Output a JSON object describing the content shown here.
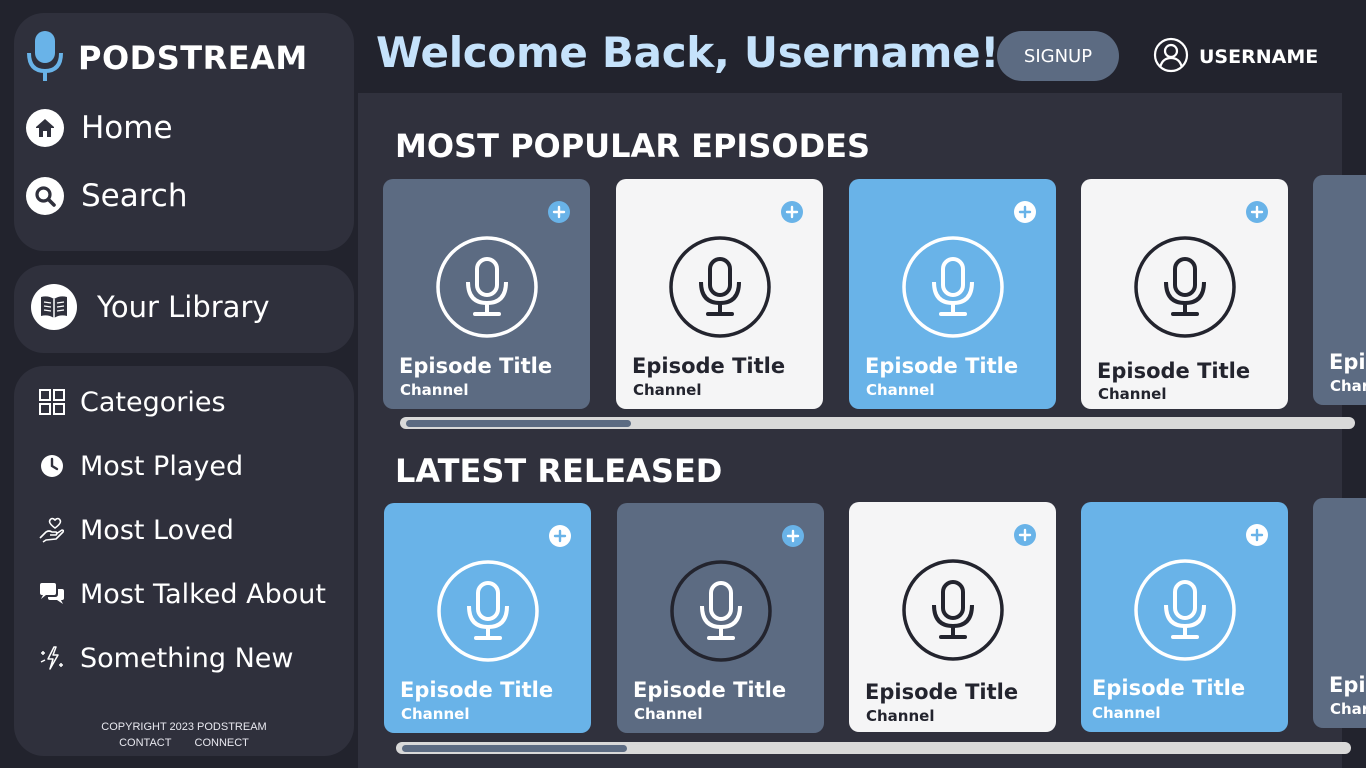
{
  "app": {
    "name": "PODSTREAM",
    "accent_color": "#69b3e8",
    "slate_color": "#5c6b82",
    "welcome_color": "#c5e2fb"
  },
  "sidebar": {
    "nav": [
      {
        "label": "Home",
        "icon": "home-icon"
      },
      {
        "label": "Search",
        "icon": "search-icon"
      }
    ],
    "library": {
      "label": "Your Library",
      "icon": "book-icon"
    },
    "categories": [
      {
        "label": "Categories",
        "icon": "grid-icon"
      },
      {
        "label": "Most Played",
        "icon": "clock-icon"
      },
      {
        "label": "Most Loved",
        "icon": "heart-hand-icon"
      },
      {
        "label": "Most Talked About",
        "icon": "chat-bubbles-icon"
      },
      {
        "label": "Something New",
        "icon": "sparkle-icon"
      }
    ],
    "footer": {
      "copyright": "COPYRIGHT 2023 PODSTREAM",
      "contact": "CONTACT",
      "connect": "CONNECT"
    }
  },
  "header": {
    "welcome": "Welcome Back, Username!",
    "signup_label": "SIGNUP",
    "username": "USERNAME"
  },
  "sections": [
    {
      "title": "MOST POPULAR EPISODES",
      "cards": [
        {
          "title": "Episode Title",
          "channel": "Channel",
          "style": "slate"
        },
        {
          "title": "Episode Title",
          "channel": "Channel",
          "style": "white"
        },
        {
          "title": "Episode Title",
          "channel": "Channel",
          "style": "blue"
        },
        {
          "title": "Episode Title",
          "channel": "Channel",
          "style": "white"
        },
        {
          "title": "Epi",
          "channel": "Char",
          "style": "peek"
        }
      ]
    },
    {
      "title": "LATEST RELEASED",
      "cards": [
        {
          "title": "Episode Title",
          "channel": "Channel",
          "style": "blue"
        },
        {
          "title": "Episode Title",
          "channel": "Channel",
          "style": "slate"
        },
        {
          "title": "Episode Title",
          "channel": "Channel",
          "style": "white"
        },
        {
          "title": "Episode Title",
          "channel": "Channel",
          "style": "blue"
        },
        {
          "title": "Epi",
          "channel": "Char",
          "style": "peek"
        }
      ]
    }
  ]
}
